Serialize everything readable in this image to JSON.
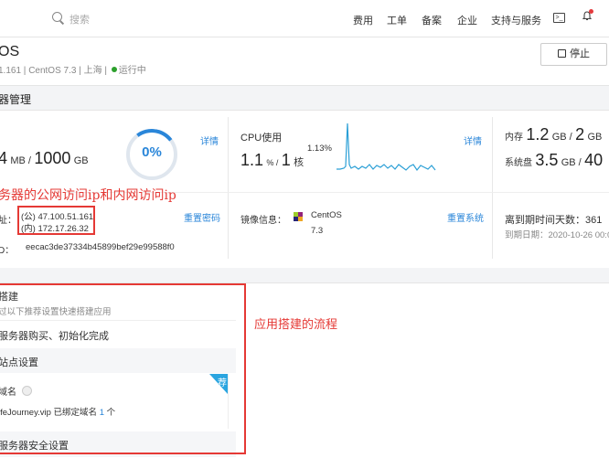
{
  "topbar": {
    "search_placeholder": "搜索",
    "nav": [
      "费用",
      "工单",
      "备案",
      "企业",
      "支持与服务"
    ],
    "terminal_icon": "terminal-icon",
    "bell_icon": "bell-icon"
  },
  "instance": {
    "name": "OS",
    "subtitle_ip": "1.161",
    "os": "CentOS 7.3",
    "region": "上海",
    "status": "运行中",
    "stop_label": "停止"
  },
  "section": {
    "title": "器管理"
  },
  "disk": {
    "used": "4",
    "used_unit": "MB /",
    "total": "1000",
    "total_unit": "GB",
    "percent": "0%",
    "detail_link": "详情"
  },
  "cpu": {
    "title": "CPU使用",
    "peak": "1.13%",
    "value": "1.1",
    "value_unit": "% /",
    "cores": "1",
    "cores_unit": "核",
    "detail_link": "详情"
  },
  "memory": {
    "label": "内存",
    "used": "1.2",
    "used_unit": "GB /",
    "total": "2",
    "total_unit": "GB",
    "sysdisk_label": "系统盘",
    "sysdisk": "3.5",
    "sysdisk_unit": "GB /",
    "sysdisk_total": "40"
  },
  "annotation_ip": "务器的公网访问ip和内网访问ip",
  "network": {
    "label": "址：",
    "public_ip": "(公) 47.100.51.161",
    "private_ip": "(内) 172.17.26.32",
    "reset_pwd": "重置密码",
    "id_label": "D：",
    "id_value": "eecac3de37334b45899bef29e99588f0"
  },
  "image": {
    "label": "镜像信息：",
    "name": "CentOS",
    "version": "7.3",
    "reset_link": "重置系统"
  },
  "expiry": {
    "days_label": "离到期时间天数：361",
    "date_label": "到期日期：2020-10-26 00:0"
  },
  "annotation_flow": "应用搭建的流程",
  "setup": {
    "title": "搭建",
    "subtitle": "过以下推荐设置快速搭建应用",
    "step1": "服务器购买、初始化完成",
    "step2": "站点设置",
    "domain_label": "域名",
    "badge": "荐",
    "domain_text": "ifeJourney.vip 已绑定域名",
    "domain_count": "1",
    "domain_count_unit": "个",
    "step3": "服务器安全设置"
  },
  "colors": {
    "accent": "#2a86d9",
    "annotation": "#e53935",
    "status": "#2ca02c",
    "badge": "#2aa5e0"
  }
}
